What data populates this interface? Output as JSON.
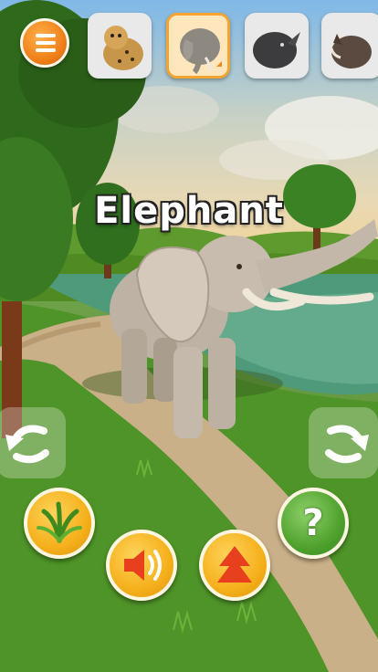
{
  "title": "Elephant",
  "animals": [
    {
      "name": "cheetah",
      "selected": false
    },
    {
      "name": "elephant",
      "selected": true
    },
    {
      "name": "rhinoceros",
      "selected": false
    },
    {
      "name": "warthog",
      "selected": false
    }
  ],
  "controls": {
    "help_label": "?"
  },
  "colors": {
    "accent_orange": "#f0801a",
    "button_yellow": "#f5b01c",
    "help_green": "#4fa22e",
    "selected_tile_border": "#f4a531"
  }
}
